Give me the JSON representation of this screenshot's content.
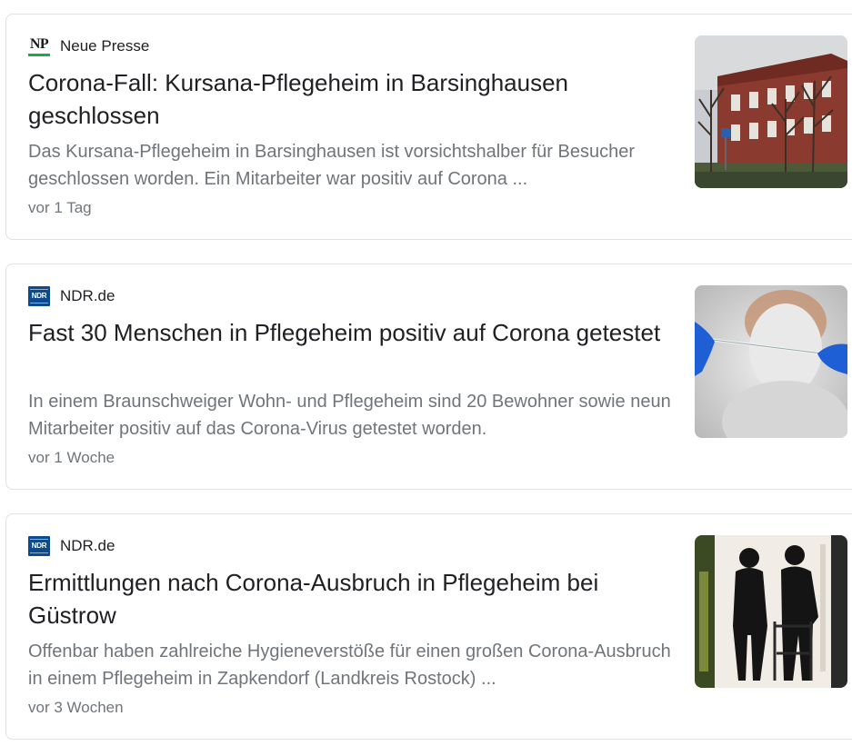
{
  "articles": [
    {
      "source": "Neue Presse",
      "favicon": "np-logo-icon",
      "favicon_text": "NP",
      "title": "Corona-Fall: Kursana-Pflegeheim in Barsinghausen geschlossen",
      "snippet": "Das Kursana-Pflegeheim in Barsinghausen ist vorsichtshalber für Besucher geschlossen worden. Ein Mitarbeiter war positiv auf Corona ...",
      "time": "vor 1 Tag",
      "thumbnail": "red-brick-building-with-trees-image"
    },
    {
      "source": "NDR.de",
      "favicon": "ndr-logo-icon",
      "favicon_text": "NDR",
      "title": "Fast 30 Menschen in Pflegeheim positiv auf Corona getestet",
      "snippet": "In einem Braunschweiger Wohn- und Pflegeheim sind 20 Bewohner sowie neun Mitarbeiter positiv auf das Corona-Virus getestet worden.",
      "time": "vor 1 Woche",
      "thumbnail": "corona-test-swab-image"
    },
    {
      "source": "NDR.de",
      "favicon": "ndr-logo-icon",
      "favicon_text": "NDR",
      "title": "Ermittlungen nach Corona-Ausbruch in Pflegeheim bei Güstrow",
      "snippet": "Offenbar haben zahlreiche Hygieneverstöße für einen großen Corona-Ausbruch in einem Pflegeheim in Zapkendorf (Landkreis Rostock) ...",
      "time": "vor 3 Wochen",
      "thumbnail": "silhouettes-with-walker-image"
    }
  ],
  "colors": {
    "title": "#202124",
    "snippet": "#70757a",
    "border": "#dfe1e5",
    "np_green": "#1fa84f",
    "ndr_blue": "#0c4a8c"
  }
}
